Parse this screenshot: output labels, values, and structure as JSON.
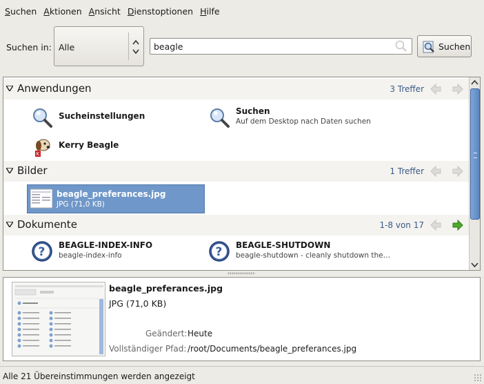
{
  "menu": {
    "items": [
      {
        "label": "Suchen",
        "u": "S",
        "rest": "uchen"
      },
      {
        "label": "Aktionen",
        "u": "A",
        "rest": "ktionen"
      },
      {
        "label": "Ansicht",
        "u": "A",
        "rest": "nsicht"
      },
      {
        "label": "Dienstoptionen",
        "u": "D",
        "rest": "ienstoptionen"
      },
      {
        "label": "Hilfe",
        "u": "H",
        "rest": "ilfe"
      }
    ]
  },
  "search": {
    "label": "Suchen in:",
    "scope_value": "Alle",
    "query": "beagle",
    "button_label": "Suchen"
  },
  "categories": [
    {
      "name": "Anwendungen",
      "count": "3 Treffer",
      "hits": [
        {
          "title": "Sucheinstellungen",
          "subtitle": "",
          "icon": "search-settings-icon"
        },
        {
          "title": "Suchen",
          "subtitle": "Auf dem Desktop nach Daten suchen",
          "icon": "search-icon"
        },
        {
          "title": "Kerry Beagle",
          "subtitle": "",
          "icon": "beagle-dog-icon"
        }
      ]
    },
    {
      "name": "Bilder",
      "count": "1 Treffer",
      "hits": [
        {
          "title": "beagle_preferances.jpg",
          "subtitle": "JPG (71,0 KB)",
          "icon": "image-thumbnail-icon"
        }
      ]
    },
    {
      "name": "Dokumente",
      "count": "1-8 von 17",
      "hits": [
        {
          "title": "BEAGLE-INDEX-INFO",
          "subtitle": "beagle-index-info",
          "icon": "help-question-icon"
        },
        {
          "title": "BEAGLE-SHUTDOWN",
          "subtitle": "beagle-shutdown - cleanly shutdown the…",
          "icon": "help-question-icon"
        }
      ]
    }
  ],
  "preview": {
    "filename": "beagle_preferances.jpg",
    "filetype": "JPG (71,0 KB)",
    "modified_label": "Geändert:",
    "modified_value": "Heute",
    "path_label": "Vollständiger Pfad:",
    "path_value": "/root/Documents/beagle_preferances.jpg"
  },
  "status": {
    "text": "Alle 21 Übereinstimmungen werden angezeigt"
  },
  "colors": {
    "selection": "#6f97c9",
    "next_active": "#4caa2c",
    "link_blue": "#3b5a88",
    "scrollbar": "#5b86c2"
  }
}
